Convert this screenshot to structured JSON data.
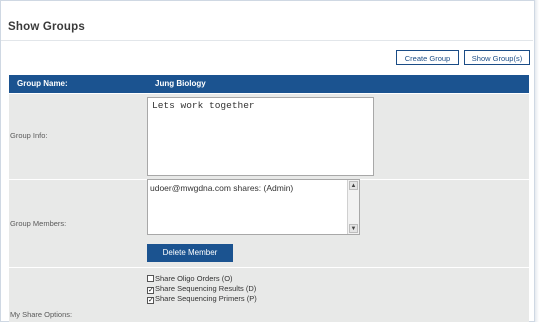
{
  "page": {
    "title": "Show Groups"
  },
  "toolbar": {
    "create_group_label": "Create Group",
    "show_groups_label": "Show Group(s)"
  },
  "table": {
    "header_label": "Group Name:",
    "header_value": "Jung Biology",
    "group_info_label": "Group Info:",
    "group_info_value": "Lets work together",
    "group_members_label": "Group Members:",
    "members": [
      "udoer@mwgdna.com shares: (Admin)"
    ],
    "delete_member_label": "Delete Member",
    "share_options_label": "My Share Options:"
  },
  "share_options": [
    {
      "label": "Share Oligo Orders (O)",
      "checked": false
    },
    {
      "label": "Share Sequencing Results (D)",
      "checked": true
    },
    {
      "label": "Share Sequencing Primers (P)",
      "checked": true
    }
  ],
  "colors": {
    "header_bg": "#1b5390",
    "row_bg": "#e8e9e8",
    "button_border": "#1a4c86"
  }
}
